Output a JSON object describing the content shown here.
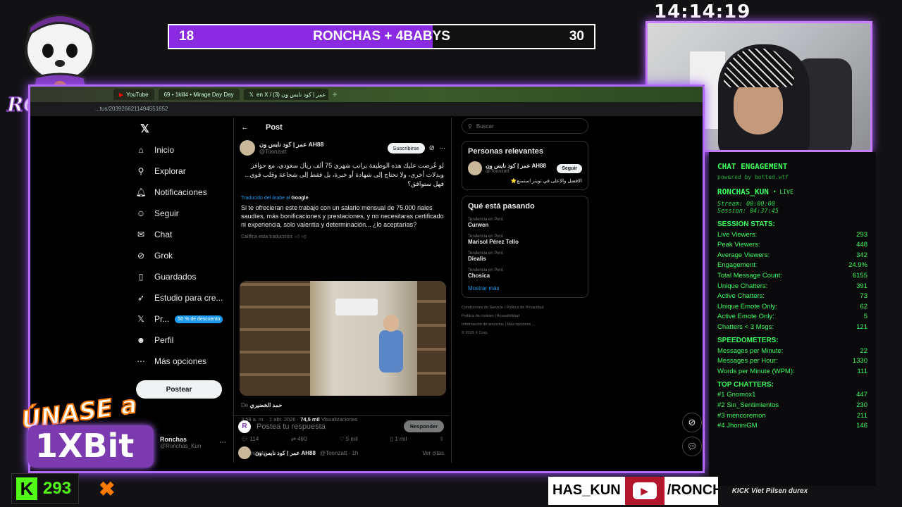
{
  "overlay": {
    "clock": "14:14:19",
    "score_left": "18",
    "score_title": "RONCHAS + 4BABYS",
    "score_right": "30",
    "logo_text": "RONCHAS",
    "promo_line1": "ÚNASE a",
    "promo_line2": "1XBit",
    "kick_count": "293",
    "bottom_name": "HAS_KUN",
    "bottom_handle": "/RONCH",
    "sponsors": "KICK  Viet  Pilsen  durex"
  },
  "browser": {
    "tabs": [
      "YouTube",
      "69 • 1kill4 • Mirage Day Day",
      "en X / عمر | كود نايس ون (3)"
    ],
    "url": "...tus/2039266211494551652"
  },
  "x_nav": {
    "items": [
      {
        "label": "Inicio",
        "icon": "home-icon"
      },
      {
        "label": "Explorar",
        "icon": "search-icon"
      },
      {
        "label": "Notificaciones",
        "icon": "bell-icon"
      },
      {
        "label": "Seguir",
        "icon": "person-plus-icon"
      },
      {
        "label": "Chat",
        "icon": "chat-icon"
      },
      {
        "label": "Grok",
        "icon": "grok-icon"
      },
      {
        "label": "Guardados",
        "icon": "bookmark-icon"
      },
      {
        "label": "Estudio para cre...",
        "icon": "rocket-icon"
      },
      {
        "label": "Pr...",
        "icon": "x-icon"
      },
      {
        "label": "Perfil",
        "icon": "person-icon"
      },
      {
        "label": "Más opciones",
        "icon": "more-icon"
      }
    ],
    "premium_badge": "50 % de descuento",
    "post_button": "Postear",
    "account_name": "Ronchas",
    "account_handle": "@Ronchas_Kun"
  },
  "post": {
    "header": "Post",
    "author_name": "عمر | كود نايس ون AH88",
    "author_handle": "@Toonzatt",
    "subscribe": "Suscribirse",
    "arabic_text": "لو عُرضت عليك هذه الوظيفة براتب شهري 75 ألف ريال سعودي، مع حوافز وبدلات أخرى، ولا تحتاج إلى شهادة أو خبرة، بل فقط إلى شجاعة وقلب قوي... فهل ستوافق؟",
    "translated_by": "Traducido del árabe al",
    "google": "Google",
    "translation": "Si te ofrecieran este trabajo con un salario mensual de 75.000 riales saudíes, más bonificaciones y prestaciones, y no necesitaras certificado ni experiencia, solo valentía y determinación... ¿lo aceptarías?",
    "rate": "Califica esta traducción:",
    "from_label": "De",
    "from_name": "حمد الخضيري",
    "timestamp": "3:58 a. m. · 1 abr. 2026 ·",
    "views": "74,5 mil",
    "views_label": "Visualizaciones",
    "replies": "114",
    "reposts": "460",
    "likes": "5 mil",
    "bookmarks": "1 mil",
    "relevant": "Relevante",
    "see_quotes": "Ver citas",
    "reply_placeholder": "Postea tu respuesta",
    "reply_button": "Responder",
    "next_author": "عمر | كود نايس ون AH88",
    "next_handle": "@Toonzatt · 1h"
  },
  "right": {
    "search_placeholder": "Buscar",
    "relevant_title": "Personas relevantes",
    "rel_name": "عمر | كود نايس ون AH88",
    "rel_handle": "@Toonzatt",
    "rel_follow": "Seguir",
    "rel_bio": "الافضل والاعلى في تويتر استمتع⭐",
    "trending_title": "Qué está pasando",
    "trends": [
      {
        "context": "Tendencia en Perú",
        "name": "Curwen"
      },
      {
        "context": "Tendencia en Perú",
        "name": "Marisol Pérez Tello"
      },
      {
        "context": "Tendencia en Perú",
        "name": "Diealis"
      },
      {
        "context": "Tendencia en Perú",
        "name": "Chosica"
      }
    ],
    "show_more": "Mostrar más",
    "footer": [
      "Condiciones de Servicio",
      "Política de Privacidad",
      "Política de cookies",
      "Accesibilidad",
      "Información de anuncios",
      "Más opciones ...",
      "© 2026 X Corp."
    ]
  },
  "chat": {
    "title": "CHAT ENGAGEMENT",
    "powered": "powered by botted.wtf",
    "user": "RONCHAS_KUN",
    "live": "• LIVE",
    "stream": "Stream: 00:00:00",
    "session": "Session: 04:37:45",
    "stats_title": "SESSION STATS:",
    "stats": [
      {
        "label": "Live Viewers:",
        "value": "293"
      },
      {
        "label": "Peak Viewers:",
        "value": "448"
      },
      {
        "label": "Average Viewers:",
        "value": "342"
      },
      {
        "label": "Engagement:",
        "value": "24.9%"
      },
      {
        "label": "Total Message Count:",
        "value": "6155"
      },
      {
        "label": "Unique Chatters:",
        "value": "391"
      },
      {
        "label": "Active Chatters:",
        "value": "73"
      },
      {
        "label": "Unique Emote Only:",
        "value": "62"
      },
      {
        "label": "Active Emote Only:",
        "value": "5"
      },
      {
        "label": "Chatters < 3 Msgs:",
        "value": "121"
      }
    ],
    "speed_title": "SPEEDOMETERS:",
    "speed": [
      {
        "label": "Messages per Minute:",
        "value": "22"
      },
      {
        "label": "Messages per Hour:",
        "value": "1330"
      },
      {
        "label": "Words per Minute (WPM):",
        "value": "111"
      }
    ],
    "top_title": "TOP CHATTERS:",
    "top": [
      {
        "label": "#1 Gnomox1",
        "value": "447"
      },
      {
        "label": "#2 Sin_Sentimientos",
        "value": "230"
      },
      {
        "label": "#3 mencoremon",
        "value": "211"
      },
      {
        "label": "#4 JhonniGM",
        "value": "146"
      }
    ]
  },
  "colors": {
    "accent": "#b36bff",
    "chat_green": "#3dfc5c",
    "kick_green": "#53fc18"
  },
  "score_progress": 0.62
}
